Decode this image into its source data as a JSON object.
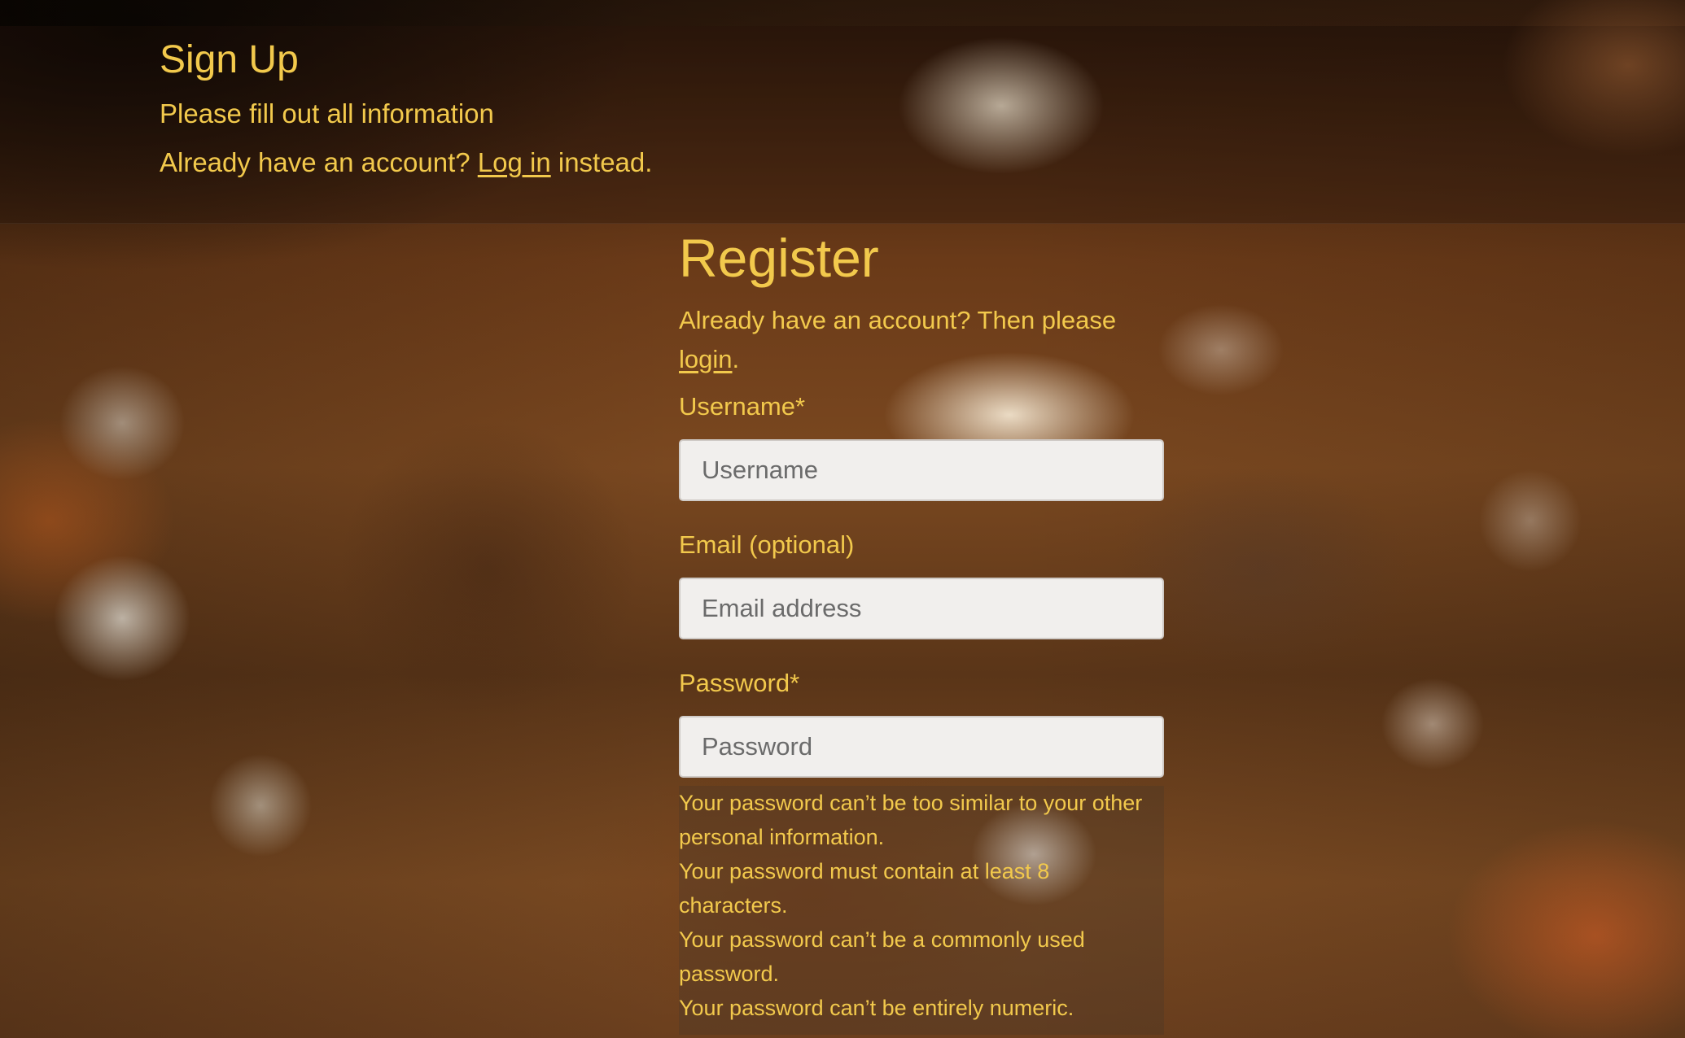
{
  "header": {
    "title": "Sign Up",
    "subtitle": "Please fill out all information",
    "login_prefix": "Already have an account? ",
    "login_link": "Log in",
    "login_suffix": " instead."
  },
  "form": {
    "title": "Register",
    "intro_prefix": "Already have an account? Then please ",
    "intro_link": "login",
    "intro_suffix": ".",
    "username": {
      "label": "Username*",
      "placeholder": "Username",
      "value": ""
    },
    "email": {
      "label": "Email (optional)",
      "placeholder": "Email address",
      "value": ""
    },
    "password": {
      "label": "Password*",
      "placeholder": "Password",
      "value": ""
    },
    "password_help": [
      "Your password can’t be too similar to your other personal information.",
      "Your password must contain at least 8 characters.",
      "Your password can’t be a commonly used password.",
      "Your password can’t be entirely numeric."
    ]
  },
  "colors": {
    "accent_text": "#f2c94c",
    "input_background": "#f1efed"
  }
}
